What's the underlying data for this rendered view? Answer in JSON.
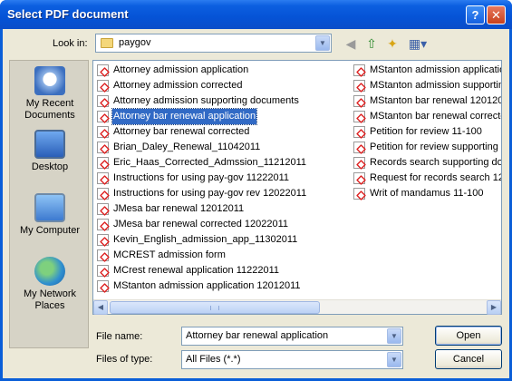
{
  "window": {
    "title": "Select PDF document"
  },
  "titlebar": {
    "help_glyph": "?",
    "close_glyph": "✕"
  },
  "lookin": {
    "label": "Look in:",
    "value": "paygov"
  },
  "toolbar": {
    "icons": [
      "back-icon",
      "up-folder-icon",
      "new-folder-icon",
      "views-menu-icon"
    ]
  },
  "places": [
    {
      "label": "My Recent Documents",
      "icon": "recent-documents-icon"
    },
    {
      "label": "Desktop",
      "icon": "desktop-icon"
    },
    {
      "label": "My Computer",
      "icon": "my-computer-icon"
    },
    {
      "label": "My Network Places",
      "icon": "network-places-icon"
    }
  ],
  "files_col1": [
    "Attorney admission application",
    "Attorney admission corrected",
    "Attorney admission supporting documents",
    "Attorney bar renewal application",
    "Attorney bar renewal corrected",
    "Brian_Daley_Renewal_11042011",
    "Eric_Haas_Corrected_Admssion_11212011",
    "Instructions for using pay-gov 11222011",
    "Instructions for using pay-gov rev 12022011",
    "JMesa bar renewal 12012011",
    "JMesa bar renewal corrected 12022011",
    "Kevin_English_admission_app_11302011",
    "MCREST admission form",
    "MCrest renewal application 11222011",
    "MStanton admission application 12012011"
  ],
  "files_col2": [
    "MStanton admission applicatio",
    "MStanton admission supportin",
    "MStanton bar renewal 120120",
    "MStanton bar renewal correcte",
    "Petition for review 11-100",
    "Petition for review supporting",
    "Records search supporting do",
    "Request for records search 12",
    "Writ of mandamus 11-100"
  ],
  "selected_file": "Attorney bar renewal application",
  "form": {
    "file_name_label": "File name:",
    "file_name_value": "Attorney bar renewal application",
    "file_type_label": "Files of type:",
    "file_type_value": "All Files (*.*)"
  },
  "buttons": {
    "open": "Open",
    "cancel": "Cancel"
  },
  "colors": {
    "title_bar": "#0553d6",
    "selection": "#316ac5",
    "dialog_bg": "#ece9d8",
    "close_button": "#c7401c"
  }
}
